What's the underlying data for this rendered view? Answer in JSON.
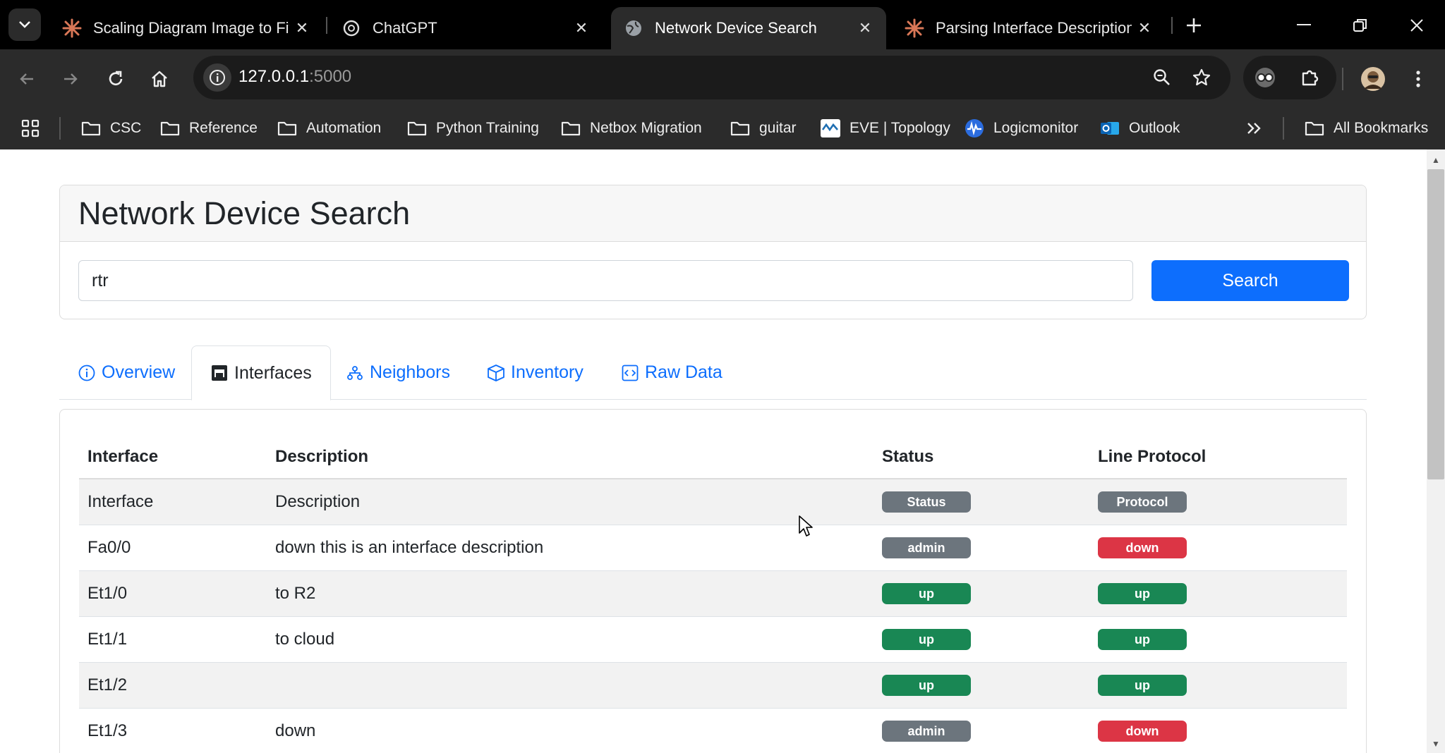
{
  "browser": {
    "tabs": [
      {
        "title": "Scaling Diagram Image to Fit",
        "favicon": "claude-icon",
        "active": false
      },
      {
        "title": "ChatGPT",
        "favicon": "chatgpt-icon",
        "active": false
      },
      {
        "title": "Network Device Search",
        "favicon": "globe-icon",
        "active": true
      },
      {
        "title": "Parsing Interface Description (",
        "favicon": "claude-icon",
        "active": false
      }
    ],
    "url_host": "127.0.0.1",
    "url_port": ":5000",
    "bookmarks": [
      {
        "label": "CSC",
        "icon": "folder-icon"
      },
      {
        "label": "Reference",
        "icon": "folder-icon"
      },
      {
        "label": "Automation",
        "icon": "folder-icon"
      },
      {
        "label": "Python Training",
        "icon": "folder-icon"
      },
      {
        "label": "Netbox Migration",
        "icon": "folder-icon"
      },
      {
        "label": "guitar",
        "icon": "folder-icon"
      },
      {
        "label": "EVE | Topology",
        "icon": "eve-icon"
      },
      {
        "label": "Logicmonitor",
        "icon": "logicmonitor-icon"
      },
      {
        "label": "Outlook",
        "icon": "outlook-icon"
      }
    ],
    "all_bookmarks_label": "All Bookmarks"
  },
  "page": {
    "title": "Network Device Search",
    "search_value": "rtr",
    "search_button": "Search",
    "nav_tabs": [
      {
        "label": "Overview",
        "icon": "info-circle-icon",
        "active": false
      },
      {
        "label": "Interfaces",
        "icon": "ethernet-icon",
        "active": true
      },
      {
        "label": "Neighbors",
        "icon": "diagram-icon",
        "active": false
      },
      {
        "label": "Inventory",
        "icon": "box-icon",
        "active": false
      },
      {
        "label": "Raw Data",
        "icon": "code-square-icon",
        "active": false
      }
    ],
    "table": {
      "headers": [
        "Interface",
        "Description",
        "Status",
        "Line Protocol"
      ],
      "rows": [
        {
          "interface": "Interface",
          "description": "Description",
          "status": "Status",
          "protocol": "Protocol",
          "status_color": "#6c757d",
          "protocol_color": "#6c757d"
        },
        {
          "interface": "Fa0/0",
          "description": "down this is an interface description",
          "status": "admin",
          "protocol": "down",
          "status_color": "#6c757d",
          "protocol_color": "#dc3545"
        },
        {
          "interface": "Et1/0",
          "description": "to R2",
          "status": "up",
          "protocol": "up",
          "status_color": "#198754",
          "protocol_color": "#198754"
        },
        {
          "interface": "Et1/1",
          "description": "to cloud",
          "status": "up",
          "protocol": "up",
          "status_color": "#198754",
          "protocol_color": "#198754"
        },
        {
          "interface": "Et1/2",
          "description": "",
          "status": "up",
          "protocol": "up",
          "status_color": "#198754",
          "protocol_color": "#198754"
        },
        {
          "interface": "Et1/3",
          "description": "down",
          "status": "admin",
          "protocol": "down",
          "status_color": "#6c757d",
          "protocol_color": "#dc3545"
        }
      ]
    }
  },
  "colors": {
    "primary": "#0d6efd",
    "success": "#198754",
    "danger": "#dc3545",
    "secondary": "#6c757d"
  }
}
